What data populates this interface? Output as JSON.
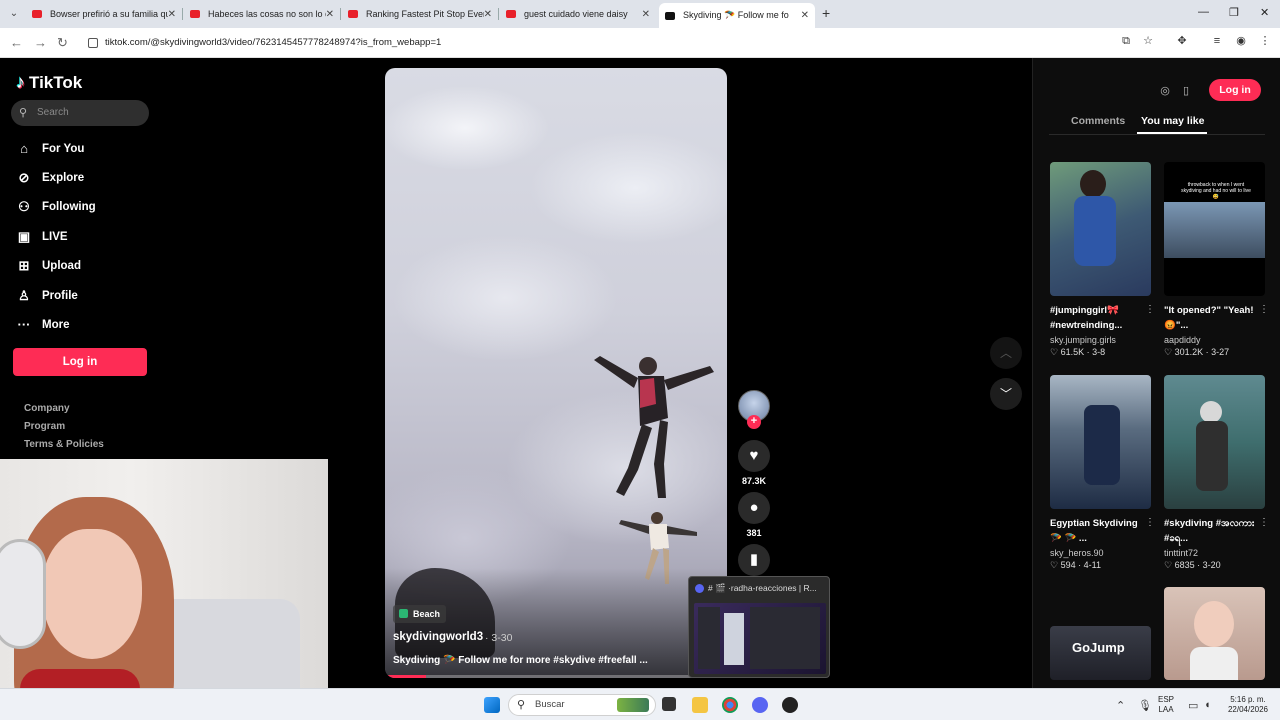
{
  "browser": {
    "tabs": [
      {
        "title": "Bowser prefirió a su familia que",
        "close": "✕"
      },
      {
        "title": "Habeces las cosas no son lo qu",
        "close": "✕"
      },
      {
        "title": "Ranking Fastest Pit Stop Ever",
        "close": "✕"
      },
      {
        "title": "guest cuidado viene daisy",
        "close": "✕"
      },
      {
        "title": "Skydiving 🪂 Follow me fo",
        "close": "✕"
      }
    ],
    "new_tab": "+",
    "url": "tiktok.com/@skydivingworld3/video/7623145457778248974?is_from_webapp=1",
    "window_controls": {
      "minimize": "—",
      "maximize": "❐",
      "close": "✕"
    }
  },
  "sidebar": {
    "logo": "TikTok",
    "search_placeholder": "Search",
    "nav": [
      {
        "label": "For You",
        "icon": "home-icon"
      },
      {
        "label": "Explore",
        "icon": "compass-icon"
      },
      {
        "label": "Following",
        "icon": "following-icon"
      },
      {
        "label": "LIVE",
        "icon": "live-icon"
      },
      {
        "label": "Upload",
        "icon": "upload-icon"
      },
      {
        "label": "Profile",
        "icon": "profile-icon"
      },
      {
        "label": "More",
        "icon": "more-icon"
      }
    ],
    "login": "Log in",
    "footer": [
      "Company",
      "Program",
      "Terms & Policies"
    ]
  },
  "video": {
    "tag": "Beach",
    "author": "skydivingworld3",
    "date": "· 3-30",
    "description": "Skydiving 🪂 Follow me for more #skydive #freefall ...",
    "progress": 0.12
  },
  "actions": {
    "likes": "87.3K",
    "comments": "381"
  },
  "preview": {
    "title": "# 🎬 ·radha-reacciones | R..."
  },
  "right_panel": {
    "login": "Log in",
    "tabs": [
      "Comments",
      "You may like"
    ],
    "active_tab": "You may like",
    "cards": [
      {
        "title": "#jumpinggirl🎀 #newtreinding...",
        "author": "sky.jumping.girls",
        "likes": "61.5K",
        "date": "3-8"
      },
      {
        "title": "\"It opened?\" \"Yeah! 😡\"...",
        "author": "aapdiddy",
        "likes": "301.2K",
        "date": "3-27",
        "overlay": "throwback to when I went skydiving and had no will to live 😅"
      },
      {
        "title": "Egyptian Skydiving 🪂 🪂 ...",
        "author": "sky_heros.90",
        "likes": "594",
        "date": "4-11"
      },
      {
        "title": "#skydiving #အလကား #ခရ...",
        "author": "tinttint72",
        "likes": "6835",
        "date": "3-20"
      }
    ],
    "bottom_card_label": "GoJump"
  },
  "taskbar": {
    "search": "Buscar",
    "lang": "ESP",
    "lang_sub": "LAA",
    "time": "5:16 p. m.",
    "date": "22/04/2026"
  }
}
